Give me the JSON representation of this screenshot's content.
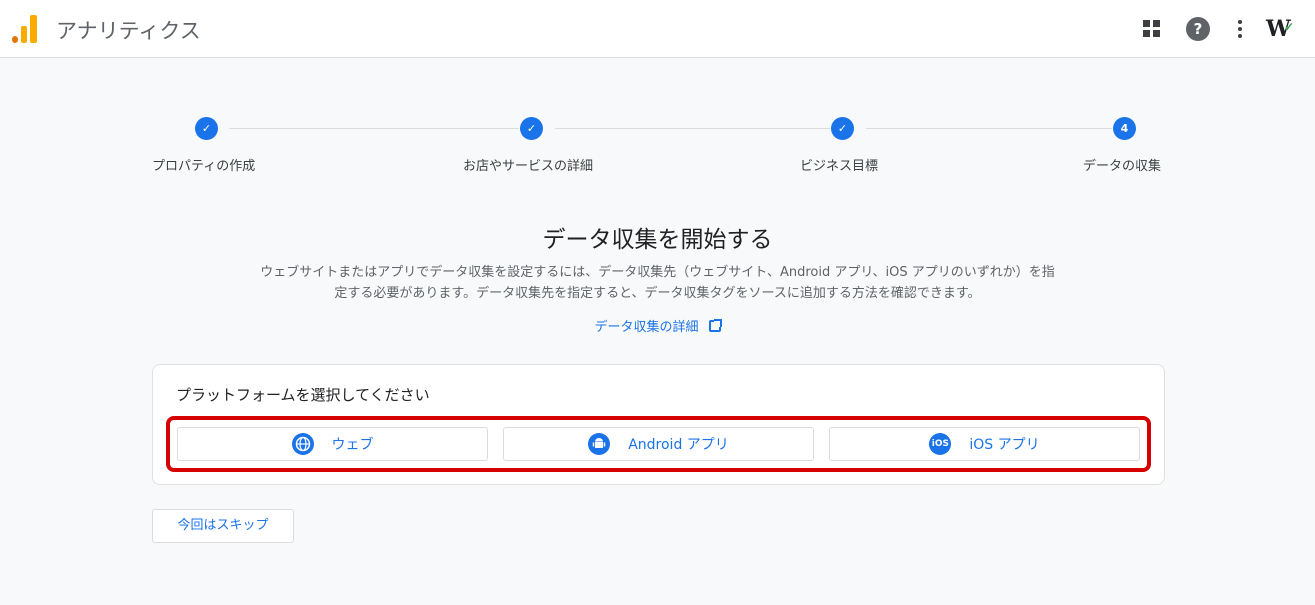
{
  "header": {
    "app_title": "アナリティクス",
    "logo_icon": "analytics-logo-icon",
    "actions": [
      "apps-grid-icon",
      "help-icon",
      "more-vert-icon",
      "account-icon"
    ],
    "help_glyph": "?",
    "account_glyph": "W"
  },
  "stepper": {
    "steps": [
      {
        "label": "プロパティの作成",
        "state": "done",
        "marker": "✓"
      },
      {
        "label": "お店やサービスの詳細",
        "state": "done",
        "marker": "✓"
      },
      {
        "label": "ビジネス目標",
        "state": "done",
        "marker": "✓"
      },
      {
        "label": "データの収集",
        "state": "current",
        "marker": "4"
      }
    ]
  },
  "main": {
    "heading": "データ収集を開始する",
    "description": "ウェブサイトまたはアプリでデータ収集を設定するには、データ収集先（ウェブサイト、Android アプリ、iOS アプリのいずれか）を指定する必要があります。データ収集先を指定すると、データ収集タグをソースに追加する方法を確認できます。",
    "learn_more_link": "データ収集の詳細",
    "learn_more_icon": "open-in-new-icon"
  },
  "platform_card": {
    "title": "プラットフォームを選択してください",
    "buttons": [
      {
        "label": "ウェブ",
        "icon": "globe-icon",
        "glyph": "🌐"
      },
      {
        "label": "Android アプリ",
        "icon": "android-icon",
        "glyph": "⬤"
      },
      {
        "label": "iOS アプリ",
        "icon": "ios-icon",
        "glyph": "iOS"
      }
    ]
  },
  "footer": {
    "skip_label": "今回はスキップ"
  },
  "colors": {
    "accent": "#1a73e8",
    "highlight": "#d50000",
    "logo_orange": "#f9ab00"
  }
}
